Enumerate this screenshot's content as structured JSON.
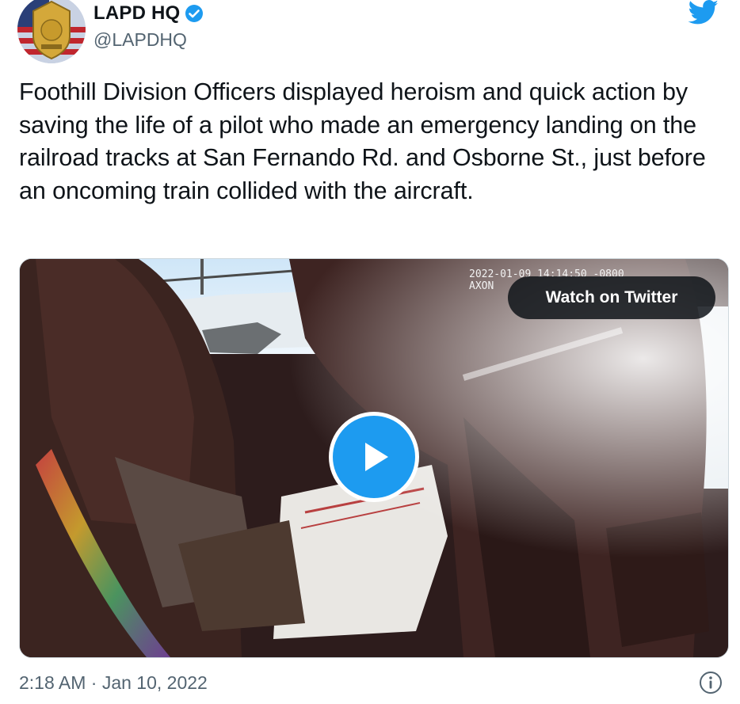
{
  "account": {
    "name": "LAPD HQ",
    "handle": "@LAPDHQ",
    "avatar_icon": "lapd-badge-avatar",
    "verified_icon": "verified-badge-icon"
  },
  "tweet": {
    "text": "Foothill Division Officers displayed heroism and quick action by saving the life of a pilot who made an emergency landing on the railroad tracks at San Fernando Rd. and Osborne St., just before an oncoming train collided with the aircraft.",
    "timestamp": "2:18 AM · Jan 10, 2022"
  },
  "media": {
    "camera_stamp": "2022-01-09 14:14:50 -0800\nAXON",
    "watch_label": "Watch on Twitter",
    "play_icon": "play-icon"
  },
  "icons": {
    "brand": "twitter-bird-icon",
    "info": "info-icon"
  },
  "colors": {
    "accent": "#1d9bf0",
    "text": "#0f1419",
    "secondary_text": "#536471"
  }
}
